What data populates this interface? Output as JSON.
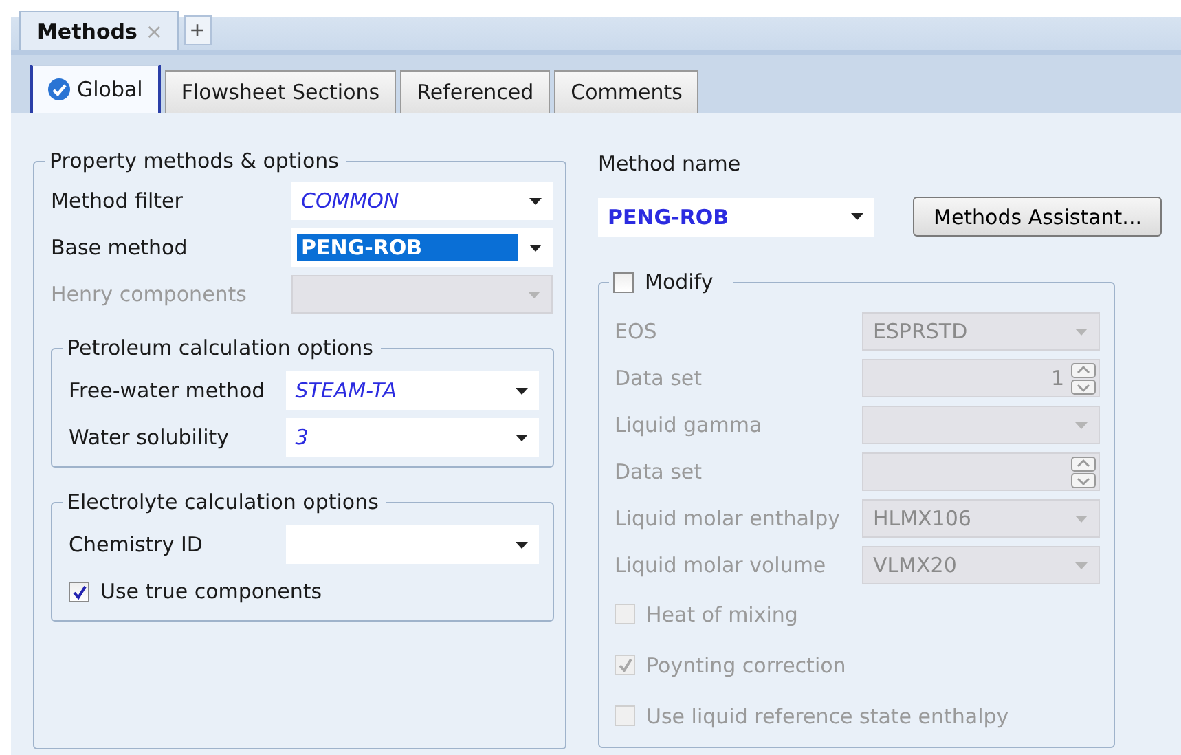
{
  "document_tabs": [
    {
      "label": "Methods",
      "selected": true,
      "close": "×"
    }
  ],
  "new_tab_button": "+",
  "tabs": [
    {
      "label": "Global",
      "selected": true,
      "complete": true
    },
    {
      "label": "Flowsheet Sections",
      "selected": false,
      "complete": false
    },
    {
      "label": "Referenced",
      "selected": false,
      "complete": false
    },
    {
      "label": "Comments",
      "selected": false,
      "complete": false
    }
  ],
  "property_group": {
    "title": "Property methods & options",
    "fields": [
      {
        "label": "Method filter",
        "value": "COMMON",
        "default_value": true,
        "highlighted": false,
        "disabled": false
      },
      {
        "label": "Base method",
        "value": "PENG-ROB",
        "default_value": false,
        "highlighted": true,
        "disabled": false
      },
      {
        "label": "Henry components",
        "disabled": true
      }
    ],
    "subgroups": [
      {
        "title": "Petroleum calculation options",
        "fields": [
          {
            "label": "Free-water method",
            "value": "STEAM-TA",
            "default_value": true,
            "highlighted": false,
            "disabled": false
          },
          {
            "label": "Water solubility",
            "value": "3",
            "default_value": true,
            "highlighted": false,
            "disabled": false
          }
        ]
      },
      {
        "title": "Electrolyte calculation options",
        "fields": [
          {
            "label": "Chemistry ID",
            "disabled": false
          }
        ],
        "checkboxes": [
          {
            "label": "Use true components",
            "checked": true,
            "disabled": false
          }
        ]
      }
    ]
  },
  "method_name": {
    "label": "Method name",
    "value": "PENG-ROB",
    "default_value": false,
    "highlighted": false
  },
  "assistant_button": "Methods Assistant...",
  "modify_group": {
    "title": "Modify",
    "checked": false,
    "fields": [
      {
        "kind": "dropdown",
        "label": "EOS",
        "value": "ESPRSTD",
        "disabled": true
      },
      {
        "kind": "spinner",
        "label": "Data set",
        "value": "1",
        "disabled": true
      },
      {
        "kind": "dropdown",
        "label": "Liquid gamma",
        "disabled": true
      },
      {
        "kind": "spinner",
        "label": "Data set",
        "disabled": true
      },
      {
        "kind": "dropdown",
        "label": "Liquid molar enthalpy",
        "value": "HLMX106",
        "disabled": true
      },
      {
        "kind": "dropdown",
        "label": "Liquid molar volume",
        "value": "VLMX20",
        "disabled": true
      }
    ],
    "checkboxes": [
      {
        "label": "Heat of mixing",
        "checked": false,
        "disabled": true
      },
      {
        "label": "Poynting correction",
        "checked": true,
        "disabled": true
      },
      {
        "label": "Use liquid reference state enthalpy",
        "checked": false,
        "disabled": true
      }
    ]
  }
}
